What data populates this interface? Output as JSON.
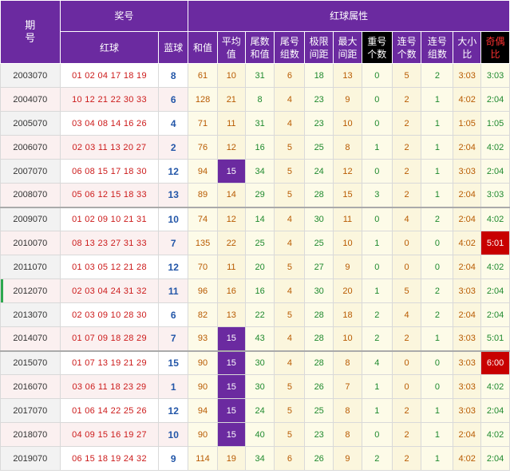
{
  "header": {
    "period": "期\n号",
    "award": "奖号",
    "red_attr": "红球属性",
    "red_ball": "红球",
    "blue_ball": "蓝球",
    "sum": "和值",
    "avg": "平均\n值",
    "tail_sum": "尾数\n和值",
    "tail_group": "尾号\n组数",
    "span": "极限\n间距",
    "max_gap": "最大\n间距",
    "repeat": "重号\n个数",
    "consec": "连号\n个数",
    "consec_group": "连号\n组数",
    "big_small": "大小\n比",
    "odd_even": "奇偶\n比"
  },
  "rows": [
    {
      "period": "2003070",
      "red": "01 02 04 17 18 19",
      "blue": "8",
      "sum": "61",
      "avg": "10",
      "tail_sum": "31",
      "tail_group": "6",
      "span": "18",
      "max_gap": "13",
      "repeat": "0",
      "consec": "5",
      "consec_group": "2",
      "big_small": "3:03",
      "odd_even": "3:03"
    },
    {
      "period": "2004070",
      "red": "10 12 21 22 30 33",
      "blue": "6",
      "sum": "128",
      "avg": "21",
      "tail_sum": "8",
      "tail_group": "4",
      "span": "23",
      "max_gap": "9",
      "repeat": "0",
      "consec": "2",
      "consec_group": "1",
      "big_small": "4:02",
      "odd_even": "2:04"
    },
    {
      "period": "2005070",
      "red": "03 04 08 14 16 26",
      "blue": "4",
      "sum": "71",
      "avg": "11",
      "tail_sum": "31",
      "tail_group": "4",
      "span": "23",
      "max_gap": "10",
      "repeat": "0",
      "consec": "2",
      "consec_group": "1",
      "big_small": "1:05",
      "odd_even": "1:05"
    },
    {
      "period": "2006070",
      "red": "02 03 11 13 20 27",
      "blue": "2",
      "sum": "76",
      "avg": "12",
      "tail_sum": "16",
      "tail_group": "5",
      "span": "25",
      "max_gap": "8",
      "repeat": "1",
      "consec": "2",
      "consec_group": "1",
      "big_small": "2:04",
      "odd_even": "4:02"
    },
    {
      "period": "2007070",
      "red": "06 08 15 17 18 30",
      "blue": "12",
      "sum": "94",
      "avg": "15",
      "tail_sum": "34",
      "tail_group": "5",
      "span": "24",
      "max_gap": "12",
      "repeat": "0",
      "consec": "2",
      "consec_group": "1",
      "big_small": "3:03",
      "odd_even": "2:04"
    },
    {
      "period": "2008070",
      "red": "05 06 12 15 18 33",
      "blue": "13",
      "sum": "89",
      "avg": "14",
      "tail_sum": "29",
      "tail_group": "5",
      "span": "28",
      "max_gap": "15",
      "repeat": "3",
      "consec": "2",
      "consec_group": "1",
      "big_small": "2:04",
      "odd_even": "3:03"
    },
    {
      "period": "2009070",
      "red": "01 02 09 10 21 31",
      "blue": "10",
      "sum": "74",
      "avg": "12",
      "tail_sum": "14",
      "tail_group": "4",
      "span": "30",
      "max_gap": "11",
      "repeat": "0",
      "consec": "4",
      "consec_group": "2",
      "big_small": "2:04",
      "odd_even": "4:02"
    },
    {
      "period": "2010070",
      "red": "08 13 23 27 31 33",
      "blue": "7",
      "sum": "135",
      "avg": "22",
      "tail_sum": "25",
      "tail_group": "4",
      "span": "25",
      "max_gap": "10",
      "repeat": "1",
      "consec": "0",
      "consec_group": "0",
      "big_small": "4:02",
      "odd_even": "5:01"
    },
    {
      "period": "2011070",
      "red": "01 03 05 12 21 28",
      "blue": "12",
      "sum": "70",
      "avg": "11",
      "tail_sum": "20",
      "tail_group": "5",
      "span": "27",
      "max_gap": "9",
      "repeat": "0",
      "consec": "0",
      "consec_group": "0",
      "big_small": "2:04",
      "odd_even": "4:02"
    },
    {
      "period": "2012070",
      "red": "02 03 04 24 31 32",
      "blue": "11",
      "sum": "96",
      "avg": "16",
      "tail_sum": "16",
      "tail_group": "4",
      "span": "30",
      "max_gap": "20",
      "repeat": "1",
      "consec": "5",
      "consec_group": "2",
      "big_small": "3:03",
      "odd_even": "2:04"
    },
    {
      "period": "2013070",
      "red": "02 03 09 10 28 30",
      "blue": "6",
      "sum": "82",
      "avg": "13",
      "tail_sum": "22",
      "tail_group": "5",
      "span": "28",
      "max_gap": "18",
      "repeat": "2",
      "consec": "4",
      "consec_group": "2",
      "big_small": "2:04",
      "odd_even": "2:04"
    },
    {
      "period": "2014070",
      "red": "01 07 09 18 28 29",
      "blue": "7",
      "sum": "93",
      "avg": "15",
      "tail_sum": "43",
      "tail_group": "4",
      "span": "28",
      "max_gap": "10",
      "repeat": "2",
      "consec": "2",
      "consec_group": "1",
      "big_small": "3:03",
      "odd_even": "5:01"
    },
    {
      "period": "2015070",
      "red": "01 07 13 19 21 29",
      "blue": "15",
      "sum": "90",
      "avg": "15",
      "tail_sum": "30",
      "tail_group": "4",
      "span": "28",
      "max_gap": "8",
      "repeat": "4",
      "consec": "0",
      "consec_group": "0",
      "big_small": "3:03",
      "odd_even": "6:00"
    },
    {
      "period": "2016070",
      "red": "03 06 11 18 23 29",
      "blue": "1",
      "sum": "90",
      "avg": "15",
      "tail_sum": "30",
      "tail_group": "5",
      "span": "26",
      "max_gap": "7",
      "repeat": "1",
      "consec": "0",
      "consec_group": "0",
      "big_small": "3:03",
      "odd_even": "4:02"
    },
    {
      "period": "2017070",
      "red": "01 06 14 22 25 26",
      "blue": "12",
      "sum": "94",
      "avg": "15",
      "tail_sum": "24",
      "tail_group": "5",
      "span": "25",
      "max_gap": "8",
      "repeat": "1",
      "consec": "2",
      "consec_group": "1",
      "big_small": "3:03",
      "odd_even": "2:04"
    },
    {
      "period": "2018070",
      "red": "04 09 15 16 19 27",
      "blue": "10",
      "sum": "90",
      "avg": "15",
      "tail_sum": "40",
      "tail_group": "5",
      "span": "23",
      "max_gap": "8",
      "repeat": "0",
      "consec": "2",
      "consec_group": "1",
      "big_small": "2:04",
      "odd_even": "4:02"
    },
    {
      "period": "2019070",
      "red": "06 15 18 19 24 32",
      "blue": "9",
      "sum": "114",
      "avg": "19",
      "tail_sum": "34",
      "tail_group": "6",
      "span": "26",
      "max_gap": "9",
      "repeat": "2",
      "consec": "2",
      "consec_group": "1",
      "big_small": "4:02",
      "odd_even": "2:04"
    }
  ],
  "highlight": {
    "avg_purple_rows": [
      4,
      11,
      12,
      13,
      14,
      15
    ],
    "odd_even_red_rows": [
      7,
      12
    ],
    "group_break_after_rows": [
      5,
      11
    ]
  },
  "colors": {
    "header_bg": "#6b2aa0",
    "highlight_purple": "#6b2aa0",
    "highlight_red": "#c80000",
    "red_number": "#cc1a1a",
    "blue_number": "#2356a8"
  }
}
